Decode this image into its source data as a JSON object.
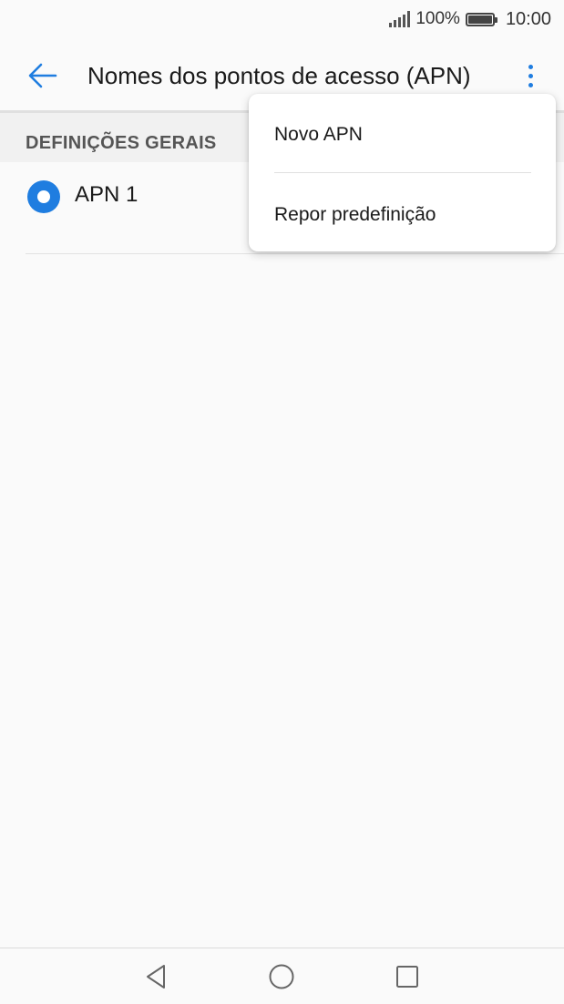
{
  "status_bar": {
    "battery_percent": "100%",
    "time": "10:00"
  },
  "app_bar": {
    "title": "Nomes dos pontos de acesso (APN)"
  },
  "section": {
    "header": "DEFINIÇÕES GERAIS"
  },
  "apn_list": [
    {
      "name": "APN 1",
      "selected": true
    }
  ],
  "overflow_menu": {
    "items": [
      {
        "label": "Novo APN"
      },
      {
        "label": "Repor predefinição"
      }
    ]
  },
  "colors": {
    "accent": "#1f7de0",
    "background": "#fafafa",
    "section_header_bg": "#f1f1f1"
  },
  "icons": {
    "back": "arrow-left-icon",
    "more": "more-vert-icon",
    "nav_back": "triangle-back-icon",
    "nav_home": "circle-home-icon",
    "nav_recents": "square-recents-icon"
  }
}
